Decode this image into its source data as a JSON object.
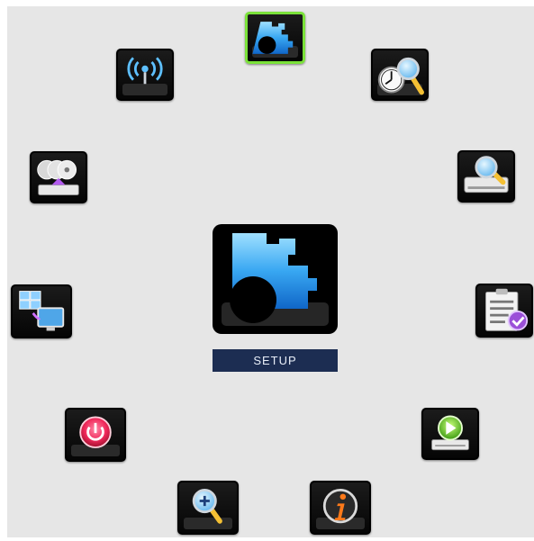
{
  "menu": {
    "selected_item": "setup",
    "items": [
      {
        "id": "setup",
        "icon": "gear-icon"
      },
      {
        "id": "time-search",
        "icon": "clock-magnifier-icon"
      },
      {
        "id": "event-search",
        "icon": "printer-magnifier-icon"
      },
      {
        "id": "event-log",
        "icon": "clipboard-check-icon"
      },
      {
        "id": "playback",
        "icon": "play-icon"
      },
      {
        "id": "information",
        "icon": "info-icon"
      },
      {
        "id": "zoom",
        "icon": "zoom-in-icon"
      },
      {
        "id": "shutdown",
        "icon": "power-icon"
      },
      {
        "id": "display",
        "icon": "multiview-monitor-icon"
      },
      {
        "id": "backup",
        "icon": "discs-upload-icon"
      },
      {
        "id": "network",
        "icon": "wireless-antenna-icon"
      }
    ]
  },
  "center": {
    "label": "SETUP",
    "icon": "gear-icon"
  },
  "colors": {
    "background": "#e6e6e6",
    "selection_border": "#7be23a",
    "label_bar": "#1c2d52",
    "icon_blue": "#3aa8f0"
  }
}
